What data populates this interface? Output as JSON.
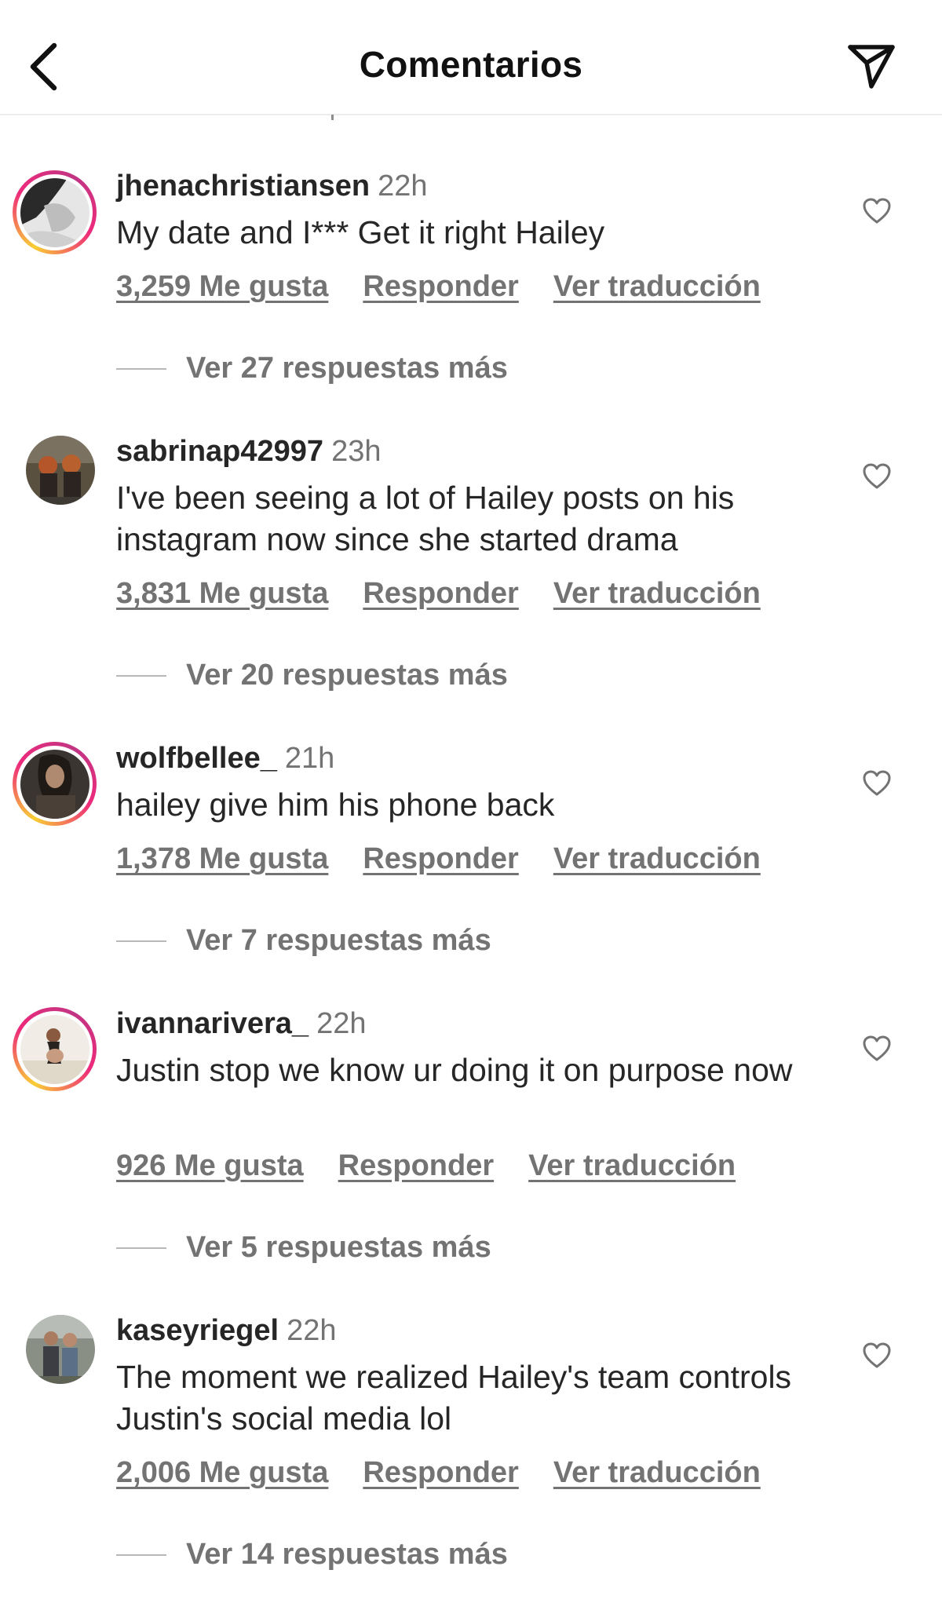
{
  "header": {
    "title": "Comentarios",
    "back_icon": "chevron-left-icon",
    "send_icon": "paper-plane-icon"
  },
  "colors": {
    "ring_gradient": [
      "#f9ce34",
      "#ee2a7b",
      "#c13584"
    ],
    "muted_text": "#737373",
    "primary_text": "#262626"
  },
  "comments": [
    {
      "username": "jhenachristiansen",
      "time": "22h",
      "text": "My date and I*** Get it right Hailey",
      "likes": "3,259 Me gusta",
      "reply_label": "Responder",
      "translate_label": "Ver traducción",
      "replies_label": "Ver 27 respuestas más",
      "story_ring": true
    },
    {
      "username": "sabrinap42997",
      "time": "23h",
      "text": "I've been seeing a lot of Hailey posts on his instagram now since she started drama",
      "likes": "3,831 Me gusta",
      "reply_label": "Responder",
      "translate_label": "Ver traducción",
      "replies_label": "Ver 20 respuestas más",
      "story_ring": false
    },
    {
      "username": "wolfbellee_",
      "time": "21h",
      "text": "hailey give him his phone back",
      "likes": "1,378 Me gusta",
      "reply_label": "Responder",
      "translate_label": "Ver traducción",
      "replies_label": "Ver 7 respuestas más",
      "story_ring": true
    },
    {
      "username": "ivannarivera_",
      "time": "22h",
      "text": "Justin stop we know ur doing it on purpose now",
      "likes": "926 Me gusta",
      "reply_label": "Responder",
      "translate_label": "Ver traducción",
      "replies_label": "Ver 5 respuestas más",
      "story_ring": true
    },
    {
      "username": "kaseyriegel",
      "time": "22h",
      "text": "The moment we realized Hailey's team controls Justin's social media lol",
      "likes": "2,006 Me gusta",
      "reply_label": "Responder",
      "translate_label": "Ver traducción",
      "replies_label": "Ver 14 respuestas más",
      "story_ring": false
    }
  ]
}
